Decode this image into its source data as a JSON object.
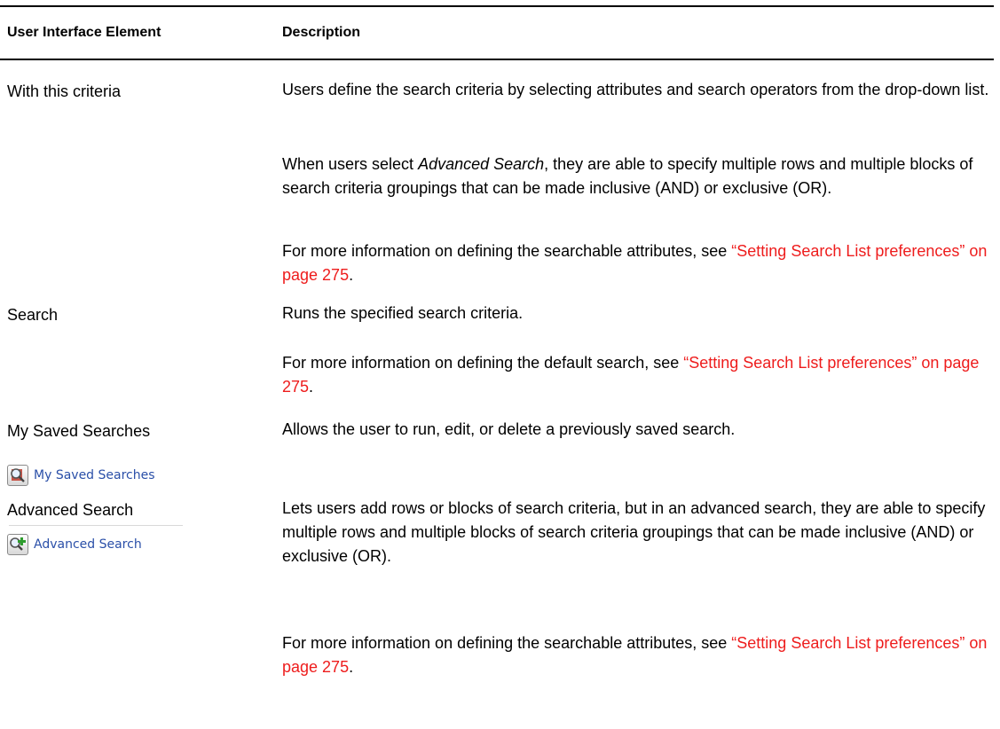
{
  "table": {
    "header": {
      "col1": "User Interface Element",
      "col2": "Description"
    },
    "rows": [
      {
        "element": "With this criteria",
        "p1": "Users define the search criteria by selecting attributes and search operators from the drop-down list.",
        "p2_pre": "When users select ",
        "p2_em": "Advanced Search",
        "p2_post": ", they are able to specify multiple rows and multiple blocks of search criteria groupings that can be made inclusive (AND) or exclusive (OR).",
        "p3_pre": "For more information on defining the searchable attributes, see ",
        "p3_link": "“Setting Search List preferences” on page 275",
        "p3_post": "."
      },
      {
        "element": "Search",
        "p1": "Runs the specified search criteria.",
        "p2_pre": "For more information on defining the default search, see ",
        "p2_link": "“Setting Search List preferences” on page 275",
        "p2_post": "."
      },
      {
        "element": "My Saved Searches",
        "p1": "Allows the user to run, edit, or delete a previously saved search.",
        "screenshot_label": "My Saved Searches",
        "icon": "saved-search-icon"
      },
      {
        "element": "Advanced Search",
        "p1": "Lets users add rows or blocks of search criteria, but in an advanced search, they are able to specify multiple rows and multiple blocks of search criteria groupings that can be made inclusive (AND) or exclusive (OR).",
        "p2_pre": "For more information on defining the searchable attributes, see ",
        "p2_link": "“Setting Search List preferences” on page 275",
        "p2_post": ".",
        "screenshot_label": "Advanced Search",
        "icon": "advanced-search-icon"
      }
    ]
  },
  "colors": {
    "link": "#ee1c1c",
    "ui_link": "#2a4fa8"
  }
}
